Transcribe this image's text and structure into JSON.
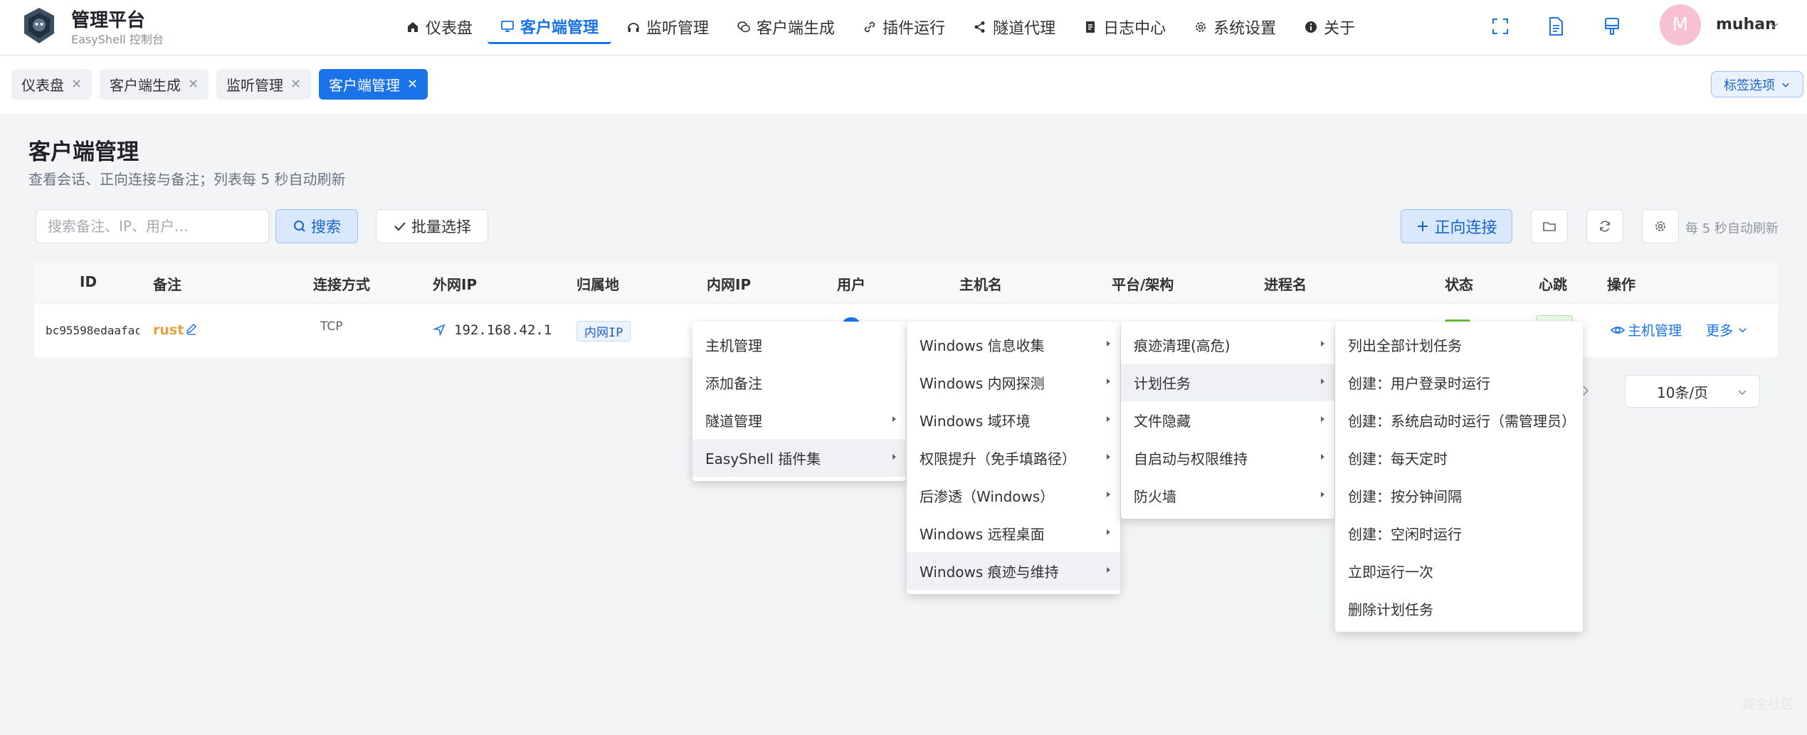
{
  "brand": {
    "title": "管理平台",
    "subtitle": "EasyShell 控制台"
  },
  "nav": [
    {
      "label": "仪表盘",
      "icon": "home-icon"
    },
    {
      "label": "客户端管理",
      "icon": "monitor-icon",
      "active": true
    },
    {
      "label": "监听管理",
      "icon": "headset-icon"
    },
    {
      "label": "客户端生成",
      "icon": "chat-icon"
    },
    {
      "label": "插件运行",
      "icon": "link-icon"
    },
    {
      "label": "隧道代理",
      "icon": "share-icon"
    },
    {
      "label": "日志中心",
      "icon": "document-icon"
    },
    {
      "label": "系统设置",
      "icon": "gear-icon"
    },
    {
      "label": "关于",
      "icon": "info-icon"
    }
  ],
  "user": {
    "avatar_letter": "M",
    "name": "muhan"
  },
  "tabs": [
    {
      "label": "仪表盘"
    },
    {
      "label": "客户端生成"
    },
    {
      "label": "监听管理"
    },
    {
      "label": "客户端管理",
      "active": true
    }
  ],
  "tag_options_label": "标签选项",
  "page": {
    "title": "客户端管理",
    "subtitle": "查看会话、正向连接与备注；列表每 5 秒自动刷新"
  },
  "toolbar": {
    "search_placeholder": "搜索备注、IP、用户…",
    "search_label": "搜索",
    "batch_label": "批量选择",
    "forward_label": "正向连接",
    "auto_refresh": "每 5 秒自动刷新"
  },
  "table": {
    "columns": [
      "ID",
      "备注",
      "连接方式",
      "外网IP",
      "归属地",
      "内网IP",
      "用户",
      "主机名",
      "平台/架构",
      "进程名",
      "状态",
      "心跳",
      "操作"
    ],
    "rows": [
      {
        "id": "bc95598edaafac",
        "note": "rust",
        "conn": "TCP",
        "public_ip": "192.168.42.1",
        "location_tag": "内网IP",
        "action_manage": "主机管理",
        "action_more": "更多"
      }
    ]
  },
  "pager": {
    "page_size": "10条/页"
  },
  "context_menu": {
    "level1": [
      "主机管理",
      "添加备注",
      "隧道管理",
      "EasyShell 插件集"
    ],
    "level2": [
      "Windows 信息收集",
      "Windows 内网探测",
      "Windows 域环境",
      "权限提升（免手填路径）",
      "后渗透（Windows）",
      "Windows 远程桌面",
      "Windows 痕迹与维持"
    ],
    "level3": [
      "痕迹清理(高危)",
      "计划任务",
      "文件隐藏",
      "自启动与权限维持",
      "防火墙"
    ],
    "level4": [
      "列出全部计划任务",
      "创建：用户登录时运行",
      "创建：系统启动时运行（需管理员）",
      "创建：每天定时",
      "创建：按分钟间隔",
      "创建：空闲时运行",
      "立即运行一次",
      "删除计划任务"
    ]
  },
  "watermark": "掘金社区",
  "colors": {
    "accent": "#1a73e8",
    "note": "#e6a23c"
  }
}
